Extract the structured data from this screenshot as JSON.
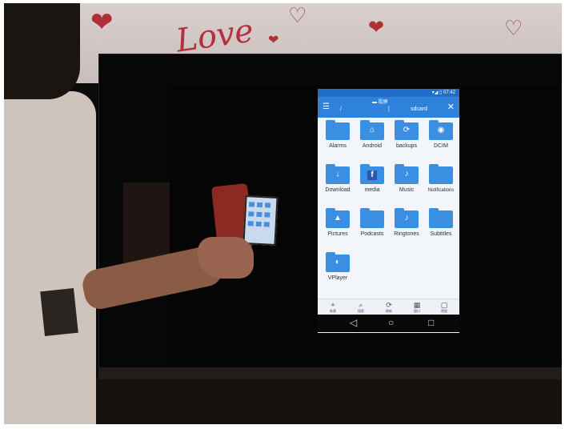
{
  "photo": {
    "wall_text": "Love",
    "scene": {
      "accent": "#b5303c",
      "screen_bg": "#f2f5f9",
      "folder_color": "#3a8fe3",
      "appbar_color": "#2f82db"
    }
  },
  "screen": {
    "statusbar": {
      "time": "07:42",
      "icons": "▾◢ ▯"
    },
    "appbar": {
      "menu_icon": "menu-icon",
      "cast_label": "▬ 投屏",
      "crumbs": [
        "/",
        "",
        "sdcard"
      ],
      "close_icon": "close-icon"
    },
    "folders": [
      {
        "label": "Alarms",
        "glyph": ""
      },
      {
        "label": "Android",
        "glyph": "⌂"
      },
      {
        "label": "backups",
        "glyph": "⟳"
      },
      {
        "label": "DCIM",
        "glyph": "◉"
      },
      {
        "label": "Download",
        "glyph": "↓"
      },
      {
        "label": "media",
        "glyph": "f"
      },
      {
        "label": "Music",
        "glyph": "♪"
      },
      {
        "label": "Notifications",
        "glyph": ""
      },
      {
        "label": "Pictures",
        "glyph": "▲"
      },
      {
        "label": "Podcasts",
        "glyph": ""
      },
      {
        "label": "Ringtones",
        "glyph": "♪"
      },
      {
        "label": "Subtitles",
        "glyph": ""
      },
      {
        "label": "VPlayer",
        "glyph": "◐"
      }
    ],
    "toolbar": [
      {
        "icon": "+",
        "label": "新建"
      },
      {
        "icon": "⌕",
        "label": "搜索"
      },
      {
        "icon": "⟳",
        "label": "刷新"
      },
      {
        "icon": "▦",
        "label": "窗口"
      },
      {
        "icon": "▢",
        "label": "视图"
      }
    ],
    "navbar": {
      "back": "◁",
      "home": "○",
      "recent": "□"
    }
  }
}
